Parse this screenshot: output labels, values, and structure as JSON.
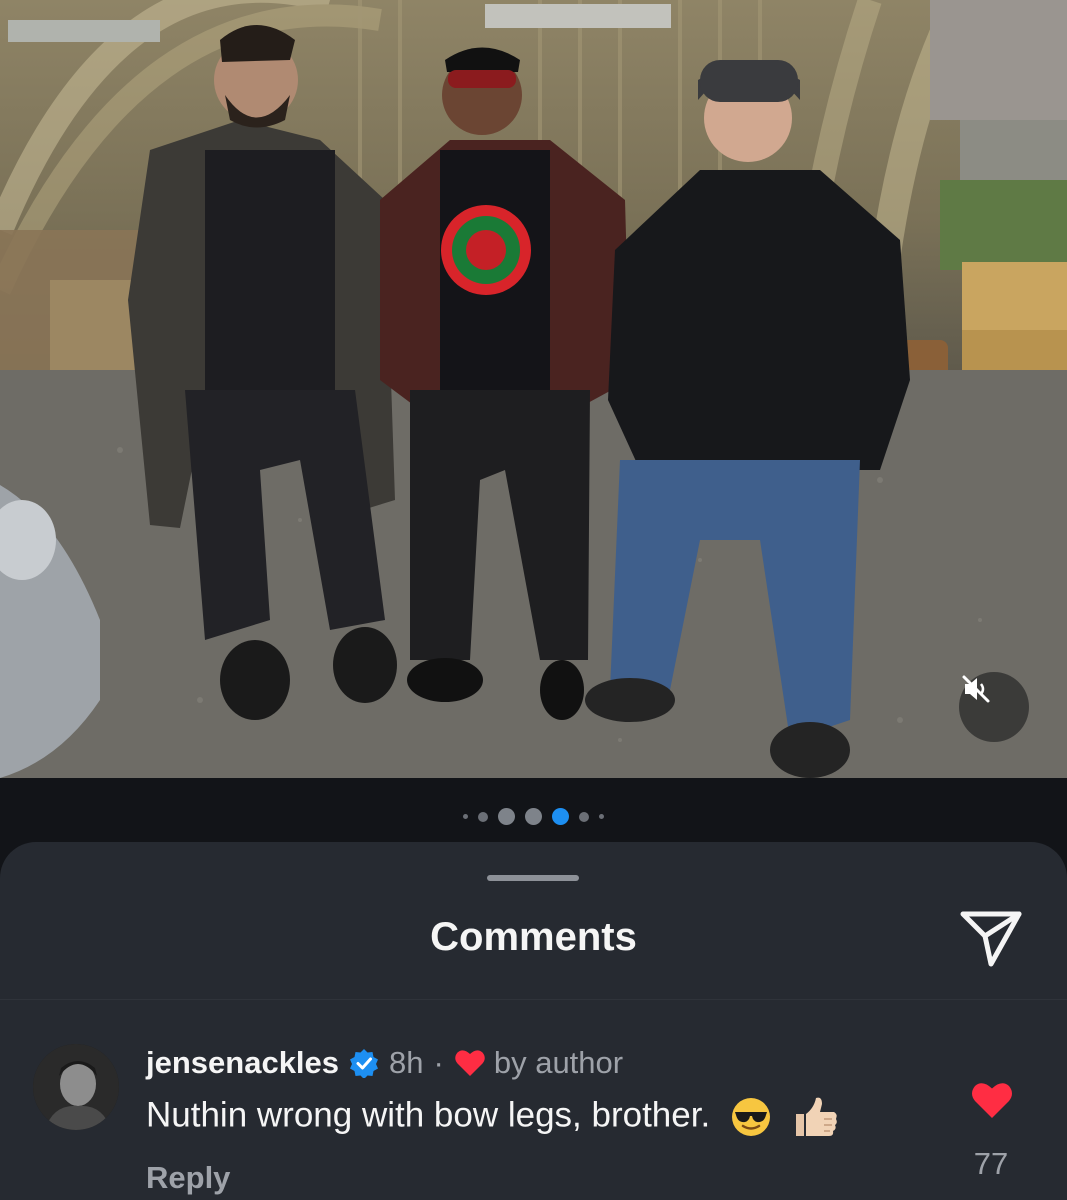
{
  "post": {
    "media_description": "three men standing in front of a quonset hut",
    "carousel": {
      "count": 8,
      "active_index": 4
    },
    "muted": true
  },
  "comments_sheet": {
    "title": "Comments"
  },
  "comments": [
    {
      "username": "jensenackles",
      "verified": true,
      "time": "8h",
      "separator": "·",
      "by_author_label": "by author",
      "text": "Nuthin wrong with bow legs, brother.",
      "emojis": [
        "smiling-face-with-sunglasses",
        "thumbs-up"
      ],
      "reply_label": "Reply",
      "like_count": "77",
      "liked": true
    }
  ],
  "colors": {
    "accent_blue": "#1d8ff2",
    "heart_red": "#ff2d43",
    "sheet_bg": "#262a31",
    "page_bg": "#121418"
  }
}
